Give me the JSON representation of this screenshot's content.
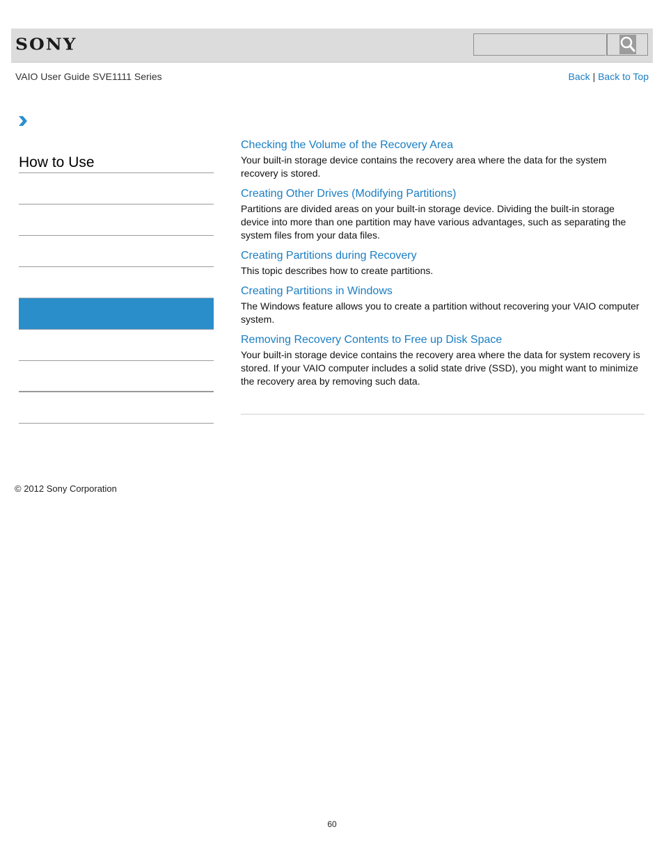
{
  "header": {
    "logo": "SONY",
    "search": {
      "placeholder": "",
      "value": ""
    },
    "search_button_icon": "search-icon"
  },
  "guide_title": "VAIO User Guide SVE1111 Series",
  "nav_links": {
    "back": "Back",
    "separator": "|",
    "back_to_top": "Back to Top"
  },
  "breadcrumb": {
    "icon": "chevron-right-icon"
  },
  "sidebar": {
    "heading": "How to Use",
    "items": [
      {
        "label": "",
        "active": false
      },
      {
        "label": "",
        "active": false
      },
      {
        "label": "",
        "active": false
      },
      {
        "label": "",
        "active": false
      },
      {
        "label": "",
        "active": true
      },
      {
        "label": "",
        "active": false
      },
      {
        "label": "",
        "active": false
      },
      {
        "label": "",
        "active": false
      }
    ]
  },
  "topics": [
    {
      "title": "Checking the Volume of the Recovery Area",
      "description": "Your built-in storage device contains the recovery area where the data for the system recovery is stored."
    },
    {
      "title": "Creating Other Drives (Modifying Partitions)",
      "description": "Partitions are divided areas on your built-in storage device. Dividing the built-in storage device into more than one partition may have various advantages, such as separating the system files from your data files."
    },
    {
      "title": "Creating Partitions during Recovery",
      "description": "This topic describes how to create partitions."
    },
    {
      "title": "Creating Partitions in Windows",
      "description": "The Windows feature allows you to create a partition without recovering your VAIO computer system."
    },
    {
      "title": "Removing Recovery Contents to Free up Disk Space",
      "description": "Your built-in storage device contains the recovery area where the data for system recovery is stored. If your VAIO computer includes a solid state drive (SSD), you might want to minimize the recovery area by removing such data."
    }
  ],
  "footer": {
    "copyright": "© 2012 Sony Corporation",
    "page_number": "60"
  },
  "colors": {
    "link": "#1a7ec3",
    "active_nav": "#2a8ecb",
    "header_bg": "#dcdcdc"
  }
}
